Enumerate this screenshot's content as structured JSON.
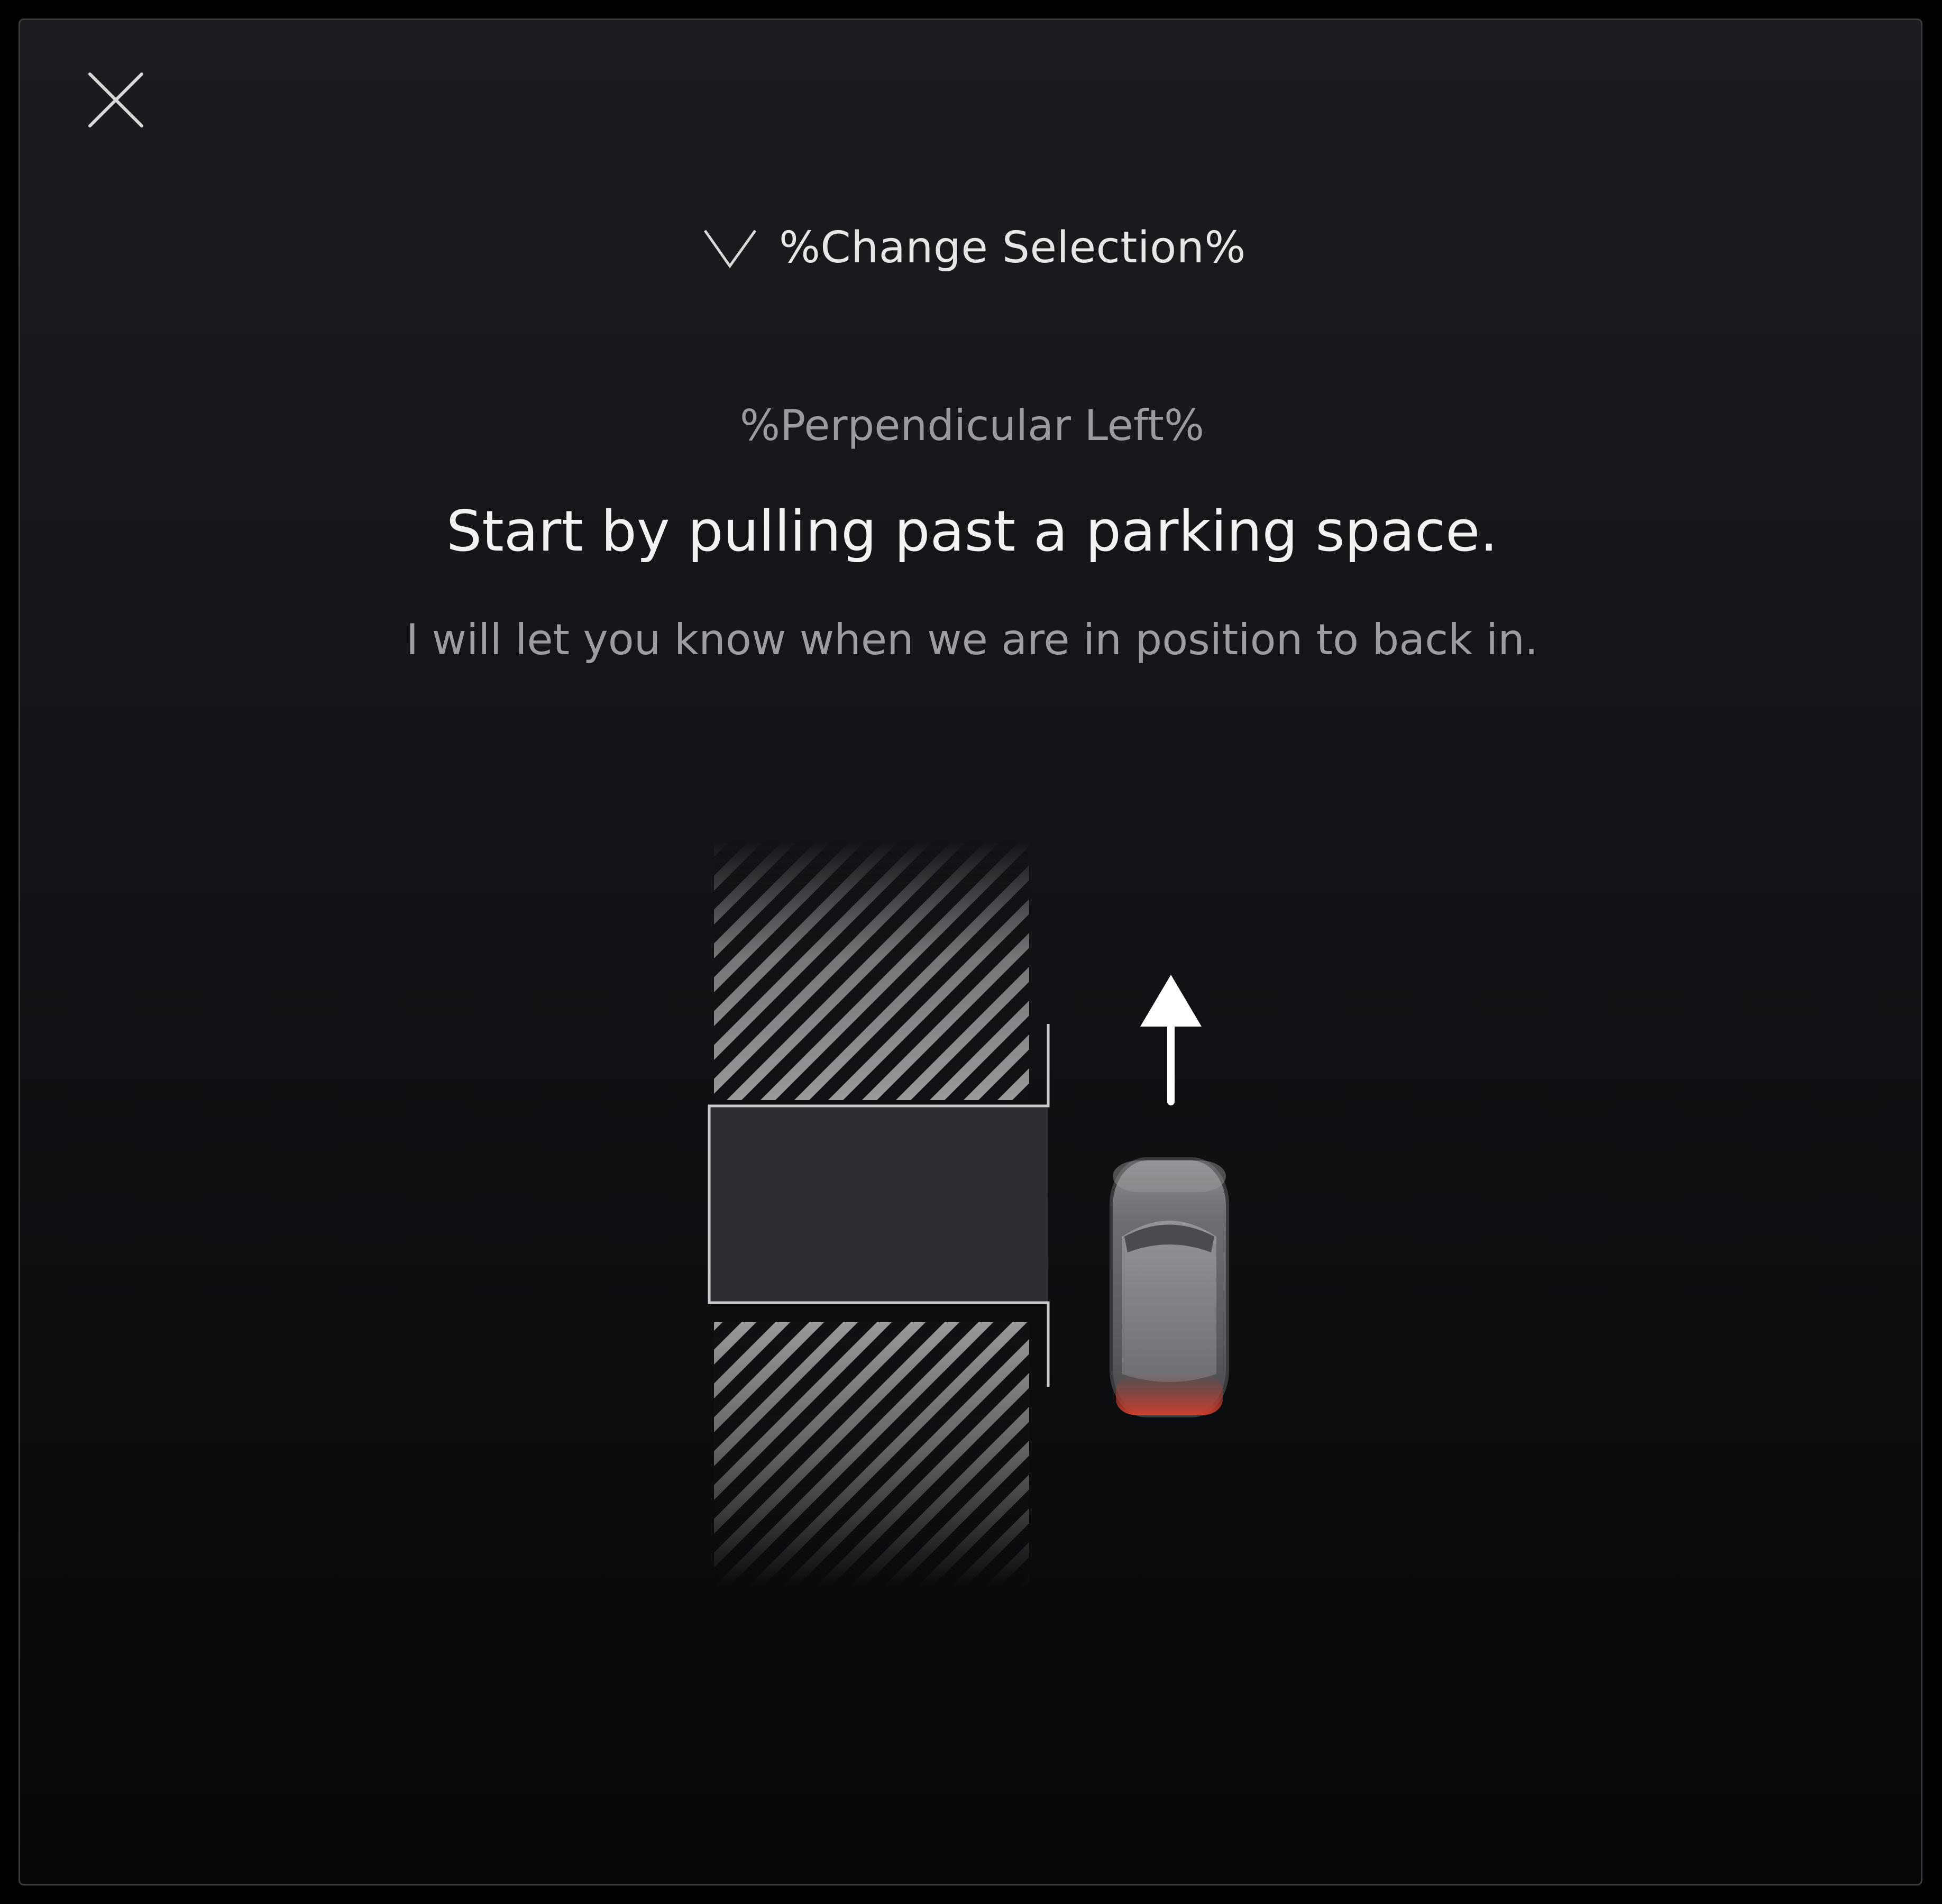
{
  "header": {
    "close_icon": "close-icon",
    "change_selection": {
      "icon": "chevron-down-icon",
      "label": "%Change Selection%"
    }
  },
  "content": {
    "mode": "%Perpendicular Left%",
    "headline": "Start by pulling past a parking space.",
    "subline": "I will let you know when we are in position to back in."
  },
  "illustration": {
    "icons": [
      "hatched-parking-area",
      "target-parking-space",
      "arrow-up-icon",
      "car-icon"
    ],
    "colors": {
      "space_fill": "#2d2e31",
      "space_outline": "#c9cacd",
      "arrow": "#ffffff",
      "tail_light": "#c0392b"
    }
  }
}
